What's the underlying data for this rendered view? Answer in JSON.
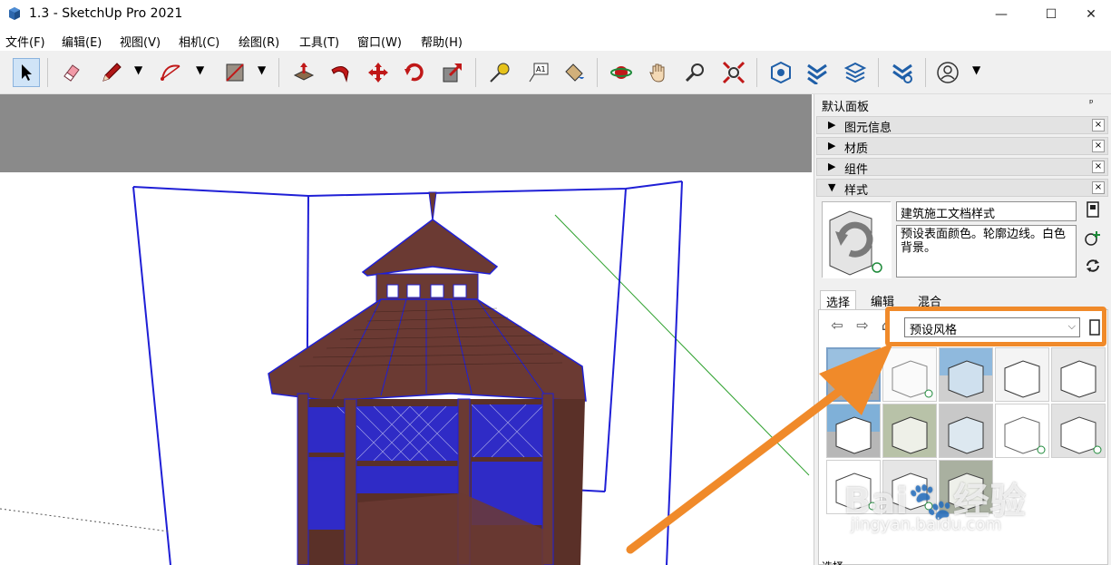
{
  "window": {
    "title": "1.3 - SketchUp Pro 2021",
    "minimize": "—",
    "maximize": "☐",
    "close": "✕"
  },
  "menu": [
    "文件(F)",
    "编辑(E)",
    "视图(V)",
    "相机(C)",
    "绘图(R)",
    "工具(T)",
    "窗口(W)",
    "帮助(H)"
  ],
  "toolbar": {
    "tools": [
      "select-tool",
      "eraser-tool",
      "line-tool",
      "arc-tool",
      "rectangle-tool",
      "push-pull-tool",
      "follow-me-tool",
      "move-tool",
      "rotate-tool",
      "scale-tool",
      "tape-measure-tool",
      "text-tool",
      "paint-bucket-tool",
      "orbit-tool",
      "pan-tool",
      "zoom-tool",
      "zoom-extents-tool",
      "warehouse-tool",
      "extension-warehouse-tool",
      "components-tool",
      "extension-manager-tool",
      "account-tool"
    ]
  },
  "tray": {
    "title": "默认面板",
    "pin": "ᵖ",
    "panels": [
      {
        "label": "图元信息",
        "expanded": false
      },
      {
        "label": "材质",
        "expanded": false
      },
      {
        "label": "组件",
        "expanded": false
      },
      {
        "label": "样式",
        "expanded": true
      }
    ],
    "close_glyph": "×",
    "style_name": "建筑施工文档样式",
    "style_description": "预设表面颜色。轮廓边线。白色背景。",
    "tabs": [
      "选择",
      "编辑",
      "混合"
    ],
    "active_tab": "选择",
    "collection": "预设风格",
    "bottom_label": "选择"
  },
  "watermark": {
    "logo": "Bai🐾经验",
    "url": "jingyan.baidu.com"
  },
  "colors": {
    "highlight": "#f08a2a",
    "model_wood": "#6b3a33",
    "selection_blue": "#1f1fd6",
    "sky": "#8a8a8a"
  }
}
